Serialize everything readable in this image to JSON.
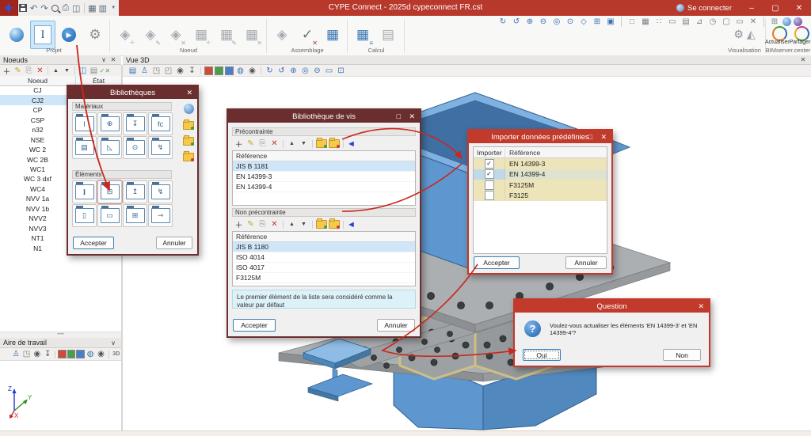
{
  "window": {
    "title": "CYPE Connect - 2025d cypeconnect FR.cst",
    "connect": "Se connecter"
  },
  "ribbon": {
    "groups": {
      "projet": "Projet",
      "noeud": "Noeud",
      "assemblage": "Assemblage",
      "calcul": "Calcul",
      "visualisation": "Visualisation",
      "bimserver": "BIMserver.center"
    },
    "buttons": {
      "actualiser": "Actualiser",
      "partager": "Partager"
    }
  },
  "noeuds": {
    "title": "Noeuds",
    "col_noeud": "Noeud",
    "col_etat": "État",
    "rows": [
      "CJ",
      "CJ2",
      "CP",
      "CSP",
      "n32",
      "NSE",
      "WC 2",
      "WC 2B",
      "WC1",
      "WC 3 dxf",
      "WC4",
      "NVV 1a",
      "NVV 1b",
      "NVV2",
      "NVV3",
      "NT1",
      "N1"
    ]
  },
  "aire": {
    "title": "Aire de travail"
  },
  "vue3d": {
    "title": "Vue 3D"
  },
  "axis": {
    "x": "X",
    "y": "Y",
    "z": "Z"
  },
  "bibliotheques": {
    "title": "Bibliothèques",
    "materiaux": "Matériaux",
    "elements": "Éléments",
    "fc": "fc",
    "accept": "Accepter",
    "cancel": "Annuler"
  },
  "vis": {
    "title": "Bibliothèque de vis",
    "pre": {
      "label": "Précontrainte",
      "col": "Référence",
      "rows": [
        "JIS B 1181",
        "EN 14399-3",
        "EN 14399-4"
      ]
    },
    "non": {
      "label": "Non précontrainte",
      "col": "Référence",
      "rows": [
        "JIS B 1180",
        "ISO 4014",
        "ISO 4017",
        "F3125M"
      ]
    },
    "note": "Le premier élément de la liste sera considéré comme la valeur par défaut",
    "accept": "Accepter",
    "cancel": "Annuler"
  },
  "importer": {
    "title": "Importer données prédéfinies",
    "col_import": "Importer",
    "col_ref": "Référence",
    "rows": [
      {
        "ref": "EN 14399-3",
        "checked": true
      },
      {
        "ref": "EN 14399-4",
        "checked": true
      },
      {
        "ref": "F3125M",
        "checked": false
      },
      {
        "ref": "F3125",
        "checked": false
      }
    ],
    "accept": "Accepter",
    "cancel": "Annuler"
  },
  "question": {
    "title": "Question",
    "message": "Voulez-vous actualiser les éléments 'EN 14399-3' et 'EN 14399-4'?",
    "yes": "Oui",
    "no": "Non"
  },
  "colors": {
    "titlebar": "#B8382B",
    "dialog_dark": "#6B2E2E",
    "dialog_red": "#C23A2B",
    "selection": "#CFE6F8",
    "steel_blue": "#5E97CF",
    "annotation": "#C8281E"
  }
}
